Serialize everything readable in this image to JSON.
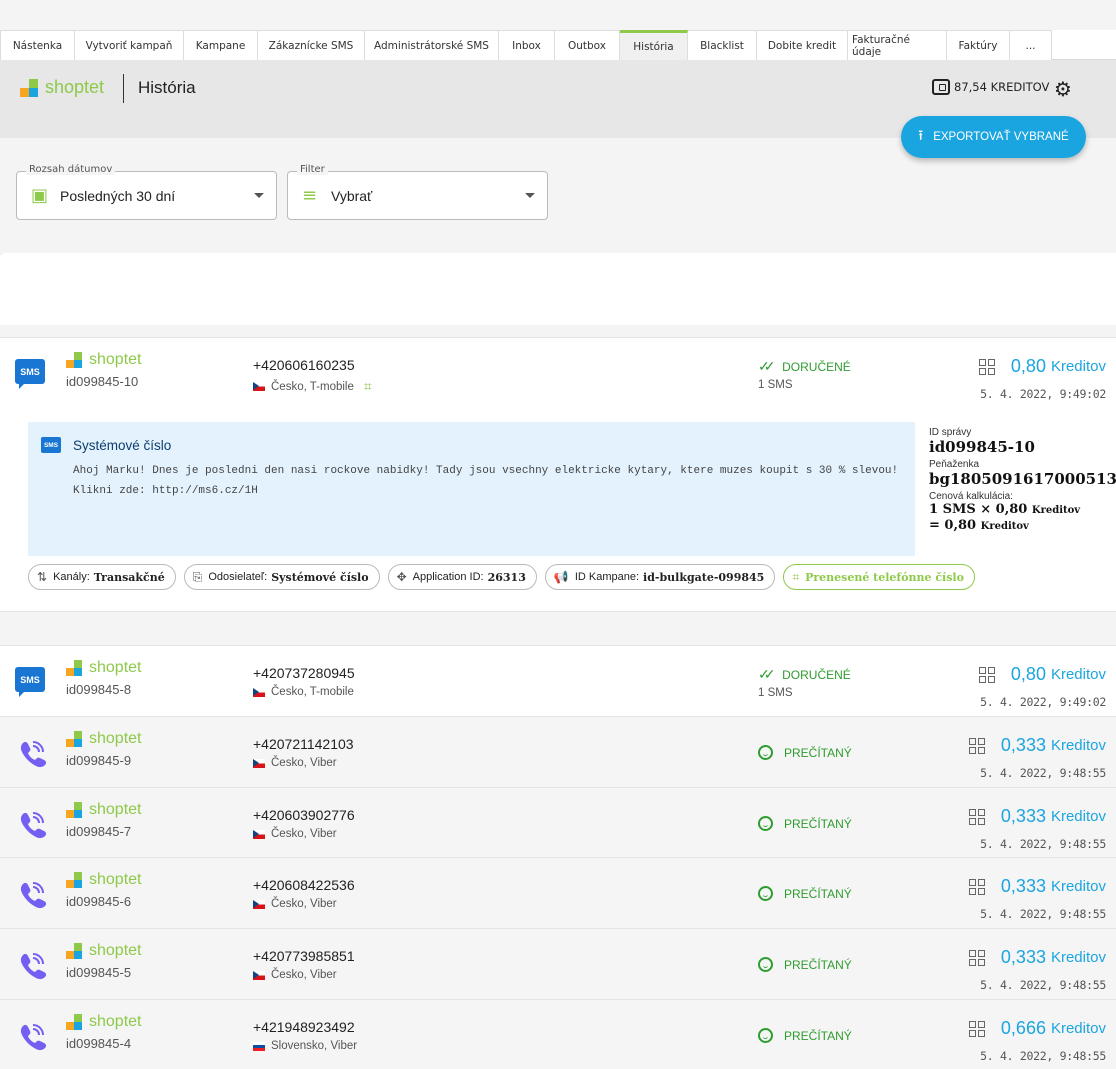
{
  "tabs": [
    {
      "label": "Nástenka",
      "w": 75
    },
    {
      "label": "Vytvoriť kampaň",
      "w": 109
    },
    {
      "label": "Kampane",
      "w": 74
    },
    {
      "label": "Zákaznícke SMS",
      "w": 107
    },
    {
      "label": "Administrátorské SMS",
      "w": 134
    },
    {
      "label": "Inbox",
      "w": 56
    },
    {
      "label": "Outbox",
      "w": 65
    },
    {
      "label": "História",
      "w": 68
    },
    {
      "label": "Blacklist",
      "w": 69
    },
    {
      "label": "Dobite kredit",
      "w": 91
    },
    {
      "label": "Fakturačné údaje",
      "w": 99
    },
    {
      "label": "Faktúry",
      "w": 63
    },
    {
      "label": "...",
      "w": 42
    }
  ],
  "active_tab": 7,
  "header": {
    "brand": "shoptet",
    "page_title": "História",
    "credit": "87,54 KREDITOV",
    "export_label": "EXPORTOVAŤ VYBRANÉ"
  },
  "filters": {
    "date_label": "Rozsah dátumov",
    "date_value": "Posledných 30 dní",
    "filter_label": "Filter",
    "filter_value": "Vybrať"
  },
  "expanded": {
    "sender_title": "Systémové číslo",
    "message": "Ahoj Marku! Dnes je posledni den nasi rockove nabidky! Tady jsou vsechny elektricke kytary, ktere muzes koupit s 30 % slevou! Klikni zde: http://ms6.cz/1H",
    "id_label": "ID správy",
    "id_value": "id099845-10",
    "wallet_label": "Peňaženka",
    "wallet_value": "bg1805091617000513",
    "calc_label": "Cenová kalkulácia:",
    "calc_line1": "1 SMS × 0,80",
    "calc_line1_unit": "Kreditov",
    "calc_line2": "= 0,80",
    "calc_line2_unit": "Kreditov",
    "chips": [
      {
        "label": "Kanály:",
        "value": "Transakčné",
        "icon": "channels-icon",
        "glyph": "⇅"
      },
      {
        "label": "Odosielateľ:",
        "value": "Systémové číslo",
        "icon": "sender-icon",
        "glyph": "⎘"
      },
      {
        "label": "Application ID:",
        "value": "26313",
        "icon": "application-icon",
        "glyph": "✥"
      },
      {
        "label": "ID Kampane:",
        "value": "id-bulkgate-099845",
        "icon": "campaign-icon",
        "glyph": "📢"
      },
      {
        "label": "",
        "value": "Prenesené telefónne číslo",
        "icon": "ported-number-icon",
        "glyph": "⌗",
        "green": true
      }
    ]
  },
  "rows": [
    {
      "channel": "sms",
      "brand": "shoptet",
      "id": "id099845-10",
      "phone": "+420606160235",
      "country": "Česko, T-mobile",
      "flag": "cz",
      "ported": true,
      "status": "DORUČENÉ",
      "status_type": "delivered",
      "parts": "1 SMS",
      "price": "0,80",
      "unit": "Kreditov",
      "date": "5. 4. 2022, 9:49:02"
    },
    {
      "channel": "sms",
      "brand": "shoptet",
      "id": "id099845-8",
      "phone": "+420737280945",
      "country": "Česko, T-mobile",
      "flag": "cz",
      "ported": false,
      "status": "DORUČENÉ",
      "status_type": "delivered",
      "parts": "1 SMS",
      "price": "0,80",
      "unit": "Kreditov",
      "date": "5. 4. 2022, 9:49:02"
    },
    {
      "channel": "viber",
      "brand": "shoptet",
      "id": "id099845-9",
      "phone": "+420721142103",
      "country": "Česko, Viber",
      "flag": "cz",
      "ported": false,
      "status": "PREČÍTANÝ",
      "status_type": "read",
      "parts": "",
      "price": "0,333",
      "unit": "Kreditov",
      "date": "5. 4. 2022, 9:48:55"
    },
    {
      "channel": "viber",
      "brand": "shoptet",
      "id": "id099845-7",
      "phone": "+420603902776",
      "country": "Česko, Viber",
      "flag": "cz",
      "ported": false,
      "status": "PREČÍTANÝ",
      "status_type": "read",
      "parts": "",
      "price": "0,333",
      "unit": "Kreditov",
      "date": "5. 4. 2022, 9:48:55"
    },
    {
      "channel": "viber",
      "brand": "shoptet",
      "id": "id099845-6",
      "phone": "+420608422536",
      "country": "Česko, Viber",
      "flag": "cz",
      "ported": false,
      "status": "PREČÍTANÝ",
      "status_type": "read",
      "parts": "",
      "price": "0,333",
      "unit": "Kreditov",
      "date": "5. 4. 2022, 9:48:55"
    },
    {
      "channel": "viber",
      "brand": "shoptet",
      "id": "id099845-5",
      "phone": "+420773985851",
      "country": "Česko, Viber",
      "flag": "cz",
      "ported": false,
      "status": "PREČÍTANÝ",
      "status_type": "read",
      "parts": "",
      "price": "0,333",
      "unit": "Kreditov",
      "date": "5. 4. 2022, 9:48:55"
    },
    {
      "channel": "viber",
      "brand": "shoptet",
      "id": "id099845-4",
      "phone": "+421948923492",
      "country": "Slovensko, Viber",
      "flag": "sk",
      "ported": false,
      "status": "PREČÍTANÝ",
      "status_type": "read",
      "parts": "",
      "price": "0,666",
      "unit": "Kreditov",
      "date": "5. 4. 2022, 9:48:55"
    }
  ],
  "colors": {
    "accent": "#1ba5e0",
    "brand_green": "#8ec94a",
    "status_green": "#2e9c2e",
    "sms_blue": "#1976d2",
    "viber_purple": "#7360f2"
  }
}
